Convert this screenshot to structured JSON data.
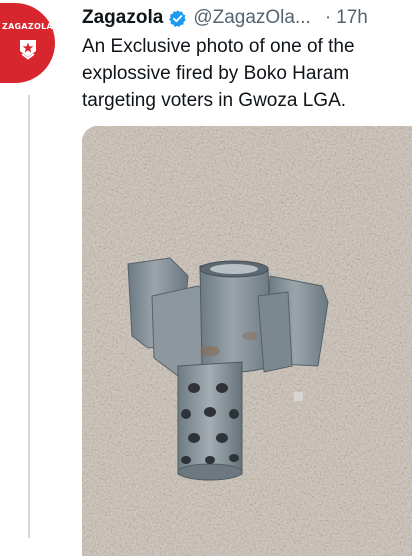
{
  "tweet": {
    "author_name": "Zagazola",
    "handle": "@ZagazOla...",
    "separator": "·",
    "time": "17h",
    "text": "An Exclusive photo of one of the\nexplossive fired by Boko Haram\ntargeting voters in Gwoza LGA."
  },
  "avatar": {
    "logo_text": "ZAGAZOLA",
    "icon": "star-badge-icon",
    "color": "#d7262e"
  },
  "verified_icon": "verified-badge-icon",
  "colors": {
    "verified": "#1d9bf0",
    "muted_text": "#536471",
    "text": "#0f1419"
  },
  "media": {
    "icon": "photo-explosive-fin-on-gravel"
  }
}
